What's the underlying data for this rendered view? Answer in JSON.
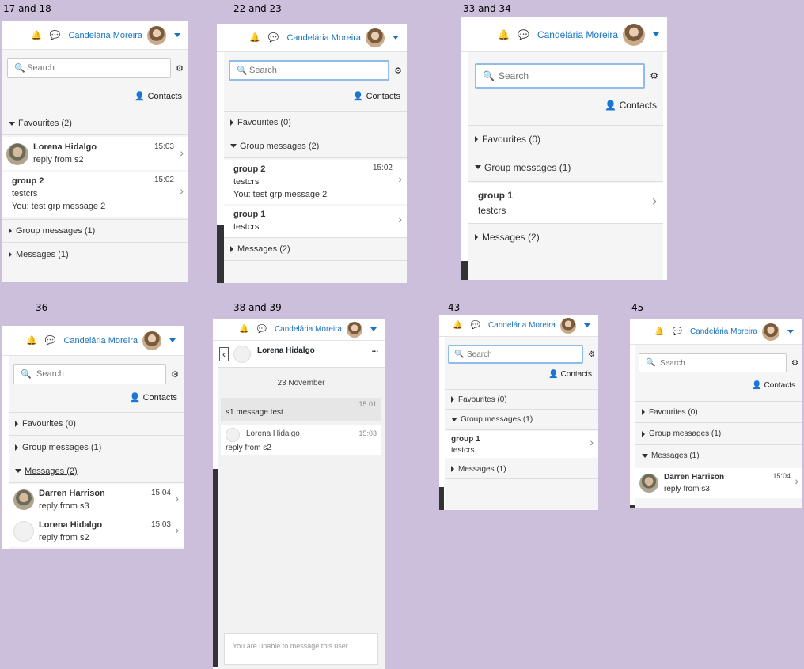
{
  "labels": {
    "p1": "17 and 18",
    "p2": "22 and 23",
    "p3": "33 and 34",
    "p4": "36",
    "p5": "38 and 39",
    "p6": "43",
    "p7": "45"
  },
  "user": "Candelária Moreira",
  "search": {
    "placeholder": "Search"
  },
  "contacts": "Contacts",
  "p1": {
    "fav": "Favourites (2)",
    "grp": "Group messages (1)",
    "msg": "Messages (1)",
    "items": [
      {
        "name": "Lorena Hidalgo",
        "time": "15:03",
        "text": "reply from s2"
      },
      {
        "name": "group 2",
        "time": "15:02",
        "line1": "testcrs",
        "line2": "You: test grp message 2"
      }
    ]
  },
  "p2": {
    "fav": "Favourites (0)",
    "grp": "Group messages (2)",
    "msg": "Messages (2)",
    "items": [
      {
        "name": "group 2",
        "time": "15:02",
        "line1": "testcrs",
        "line2": "You: test grp message 2"
      },
      {
        "name": "group 1",
        "line1": "testcrs"
      }
    ]
  },
  "p3": {
    "fav": "Favourites (0)",
    "grp": "Group messages (1)",
    "msg": "Messages (2)",
    "items": [
      {
        "name": "group 1",
        "line1": "testcrs"
      }
    ]
  },
  "p4": {
    "fav": "Favourites (0)",
    "grp": "Group messages (1)",
    "msg": "Messages (2)",
    "items": [
      {
        "name": "Darren Harrison",
        "time": "15:04",
        "text": "reply from s3"
      },
      {
        "name": "Lorena Hidalgo",
        "time": "15:03",
        "text": "reply from s2"
      }
    ]
  },
  "p5": {
    "contact": "Lorena Hidalgo",
    "more": "...",
    "date": "23 November",
    "msgs": [
      {
        "text": "s1 message test",
        "time": "15:01"
      },
      {
        "name": "Lorena Hidalgo",
        "time": "15:03",
        "text": "reply from s2"
      }
    ],
    "unable": "You are unable to message this user"
  },
  "p6": {
    "fav": "Favourites (0)",
    "grp": "Group messages (1)",
    "msg": "Messages (1)",
    "items": [
      {
        "name": "group 1",
        "line1": "testcrs"
      }
    ]
  },
  "p7": {
    "fav": "Favourites (0)",
    "grp": "Group messages (1)",
    "msg": "Messages (1)",
    "items": [
      {
        "name": "Darren Harrison",
        "time": "15:04",
        "text": "reply from s3"
      }
    ]
  }
}
